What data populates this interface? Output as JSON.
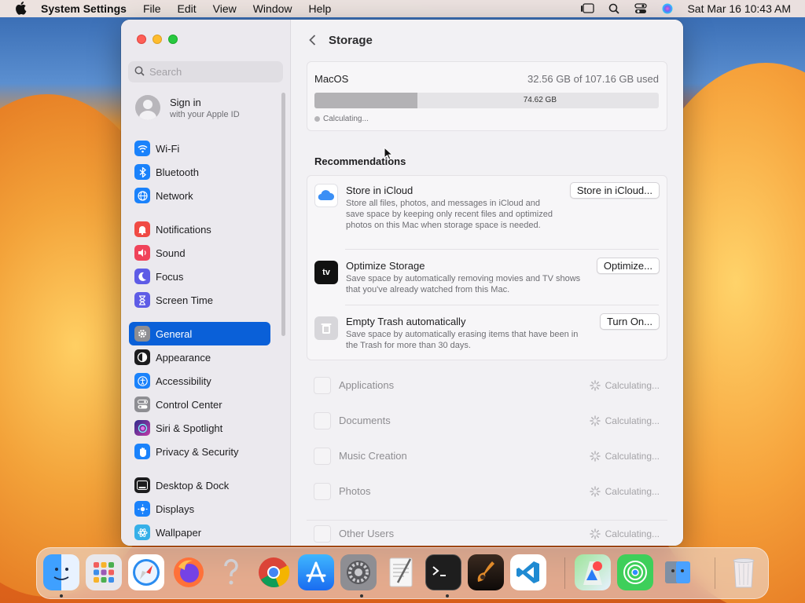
{
  "menubar": {
    "app_name": "System Settings",
    "items": [
      "File",
      "Edit",
      "View",
      "Window",
      "Help"
    ],
    "clock": "Sat Mar 16  10:43 AM"
  },
  "window": {
    "search_placeholder": "Search",
    "signin": {
      "title": "Sign in",
      "subtitle": "with your Apple ID"
    },
    "sidebar_items": [
      {
        "label": "Wi-Fi",
        "icon": "wifi-icon",
        "color": "#1a82fb"
      },
      {
        "label": "Bluetooth",
        "icon": "bluetooth-icon",
        "color": "#1a82fb"
      },
      {
        "label": "Network",
        "icon": "globe-icon",
        "color": "#1a82fb"
      },
      {
        "label": "Notifications",
        "icon": "bell-icon",
        "color": "#f04a44"
      },
      {
        "label": "Sound",
        "icon": "speaker-icon",
        "color": "#f0435a"
      },
      {
        "label": "Focus",
        "icon": "moon-icon",
        "color": "#5e5ce6"
      },
      {
        "label": "Screen Time",
        "icon": "hourglass-icon",
        "color": "#5e5ce6"
      },
      {
        "label": "General",
        "icon": "gear-icon",
        "color": "#8e8e93",
        "selected": true
      },
      {
        "label": "Appearance",
        "icon": "appearance-icon",
        "color": "#1c1c1e"
      },
      {
        "label": "Accessibility",
        "icon": "accessibility-icon",
        "color": "#1a82fb"
      },
      {
        "label": "Control Center",
        "icon": "toggles-icon",
        "color": "#8e8e93"
      },
      {
        "label": "Siri & Spotlight",
        "icon": "siri-icon",
        "color": "#7a3cc6"
      },
      {
        "label": "Privacy & Security",
        "icon": "hand-icon",
        "color": "#1a82fb"
      },
      {
        "label": "Desktop & Dock",
        "icon": "dock-icon",
        "color": "#1c1c1e"
      },
      {
        "label": "Displays",
        "icon": "sun-icon",
        "color": "#1a82fb"
      },
      {
        "label": "Wallpaper",
        "icon": "flower-icon",
        "color": "#36b0e8"
      }
    ],
    "main": {
      "title": "Storage",
      "disk": {
        "name": "MacOS",
        "used_text": "32.56 GB of 107.16 GB used",
        "free_label": "74.62 GB",
        "used_fraction": 0.3,
        "status": "Calculating..."
      },
      "recommendations_heading": "Recommendations",
      "recommendations": [
        {
          "title": "Store in iCloud",
          "desc": "Store all files, photos, and messages in iCloud and save space by keeping only recent files and optimized photos on this Mac when storage space is needed.",
          "button": "Store in iCloud...",
          "icon": "icloud-icon"
        },
        {
          "title": "Optimize Storage",
          "desc": "Save space by automatically removing movies and TV shows that you've already watched from this Mac.",
          "button": "Optimize...",
          "icon": "appletv-icon"
        },
        {
          "title": "Empty Trash automatically",
          "desc": "Save space by automatically erasing items that have been in the Trash for more than 30 days.",
          "button": "Turn On...",
          "icon": "trash-icon"
        }
      ],
      "categories": [
        {
          "name": "Applications",
          "status": "Calculating..."
        },
        {
          "name": "Documents",
          "status": "Calculating..."
        },
        {
          "name": "Music Creation",
          "status": "Calculating..."
        },
        {
          "name": "Photos",
          "status": "Calculating..."
        },
        {
          "name": "Other Users",
          "status": "Calculating..."
        }
      ],
      "tv_glyph": "tv"
    }
  },
  "dock": {
    "apps": [
      "Finder",
      "Launchpad",
      "Safari",
      "Firefox",
      "Help",
      "Chrome",
      "App Store",
      "System Settings",
      "TextEdit",
      "Terminal",
      "GarageBand",
      "Visual Studio Code",
      "Maps",
      "Find My",
      "Migration Assistant",
      "Trash"
    ]
  }
}
